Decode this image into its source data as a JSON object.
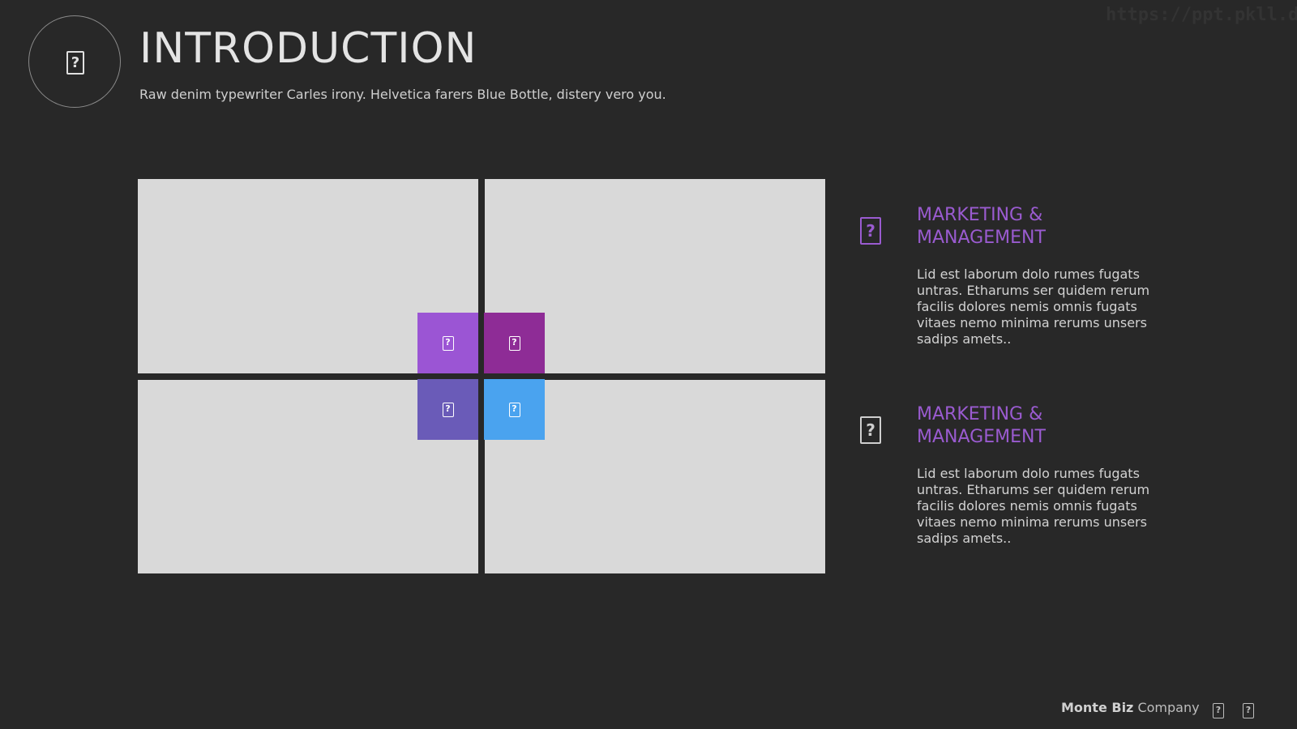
{
  "header": {
    "icon": "unknown-glyph-icon",
    "glyph": "?",
    "title": "INTRODUCTION",
    "subtitle": "Raw denim typewriter Carles irony. Helvetica farers Blue Bottle, distery vero you."
  },
  "watermark": "https://ppt.pkll.de",
  "tiles": [
    {
      "icon": "unknown-glyph-icon",
      "glyph": "?",
      "color": "#9b55d4"
    },
    {
      "icon": "unknown-glyph-icon",
      "glyph": "?",
      "color": "#8e2c96"
    },
    {
      "icon": "unknown-glyph-icon",
      "glyph": "?",
      "color": "#6a5bb8"
    },
    {
      "icon": "unknown-glyph-icon",
      "glyph": "?",
      "color": "#4aa3ef"
    }
  ],
  "features": [
    {
      "icon": "unknown-glyph-icon",
      "glyph": "?",
      "icon_color": "#9a5bd0",
      "title": "MARKETING & MANAGEMENT",
      "title_color": "#9a5bd0",
      "body": "Lid est laborum dolo rumes fugats untras. Etharums ser quidem rerum facilis dolores nemis omnis fugats vitaes nemo minima rerums unsers sadips amets.."
    },
    {
      "icon": "unknown-glyph-icon",
      "glyph": "?",
      "icon_color": "#cfcfcf",
      "title": "MARKETING & MANAGEMENT",
      "title_color": "#9a5bd0",
      "body": "Lid est laborum dolo rumes fugats untras. Etharums ser quidem rerum facilis dolores nemis omnis fugats vitaes nemo minima rerums unsers sadips amets.."
    }
  ],
  "footer": {
    "brand_bold": "Monte Biz",
    "brand_rest": " Company",
    "icons": [
      {
        "icon": "unknown-glyph-icon",
        "glyph": "?"
      },
      {
        "icon": "unknown-glyph-icon",
        "glyph": "?"
      }
    ]
  },
  "colors": {
    "background": "#282828",
    "panel": "#d9d9d9",
    "accent": "#9a5bd0"
  }
}
